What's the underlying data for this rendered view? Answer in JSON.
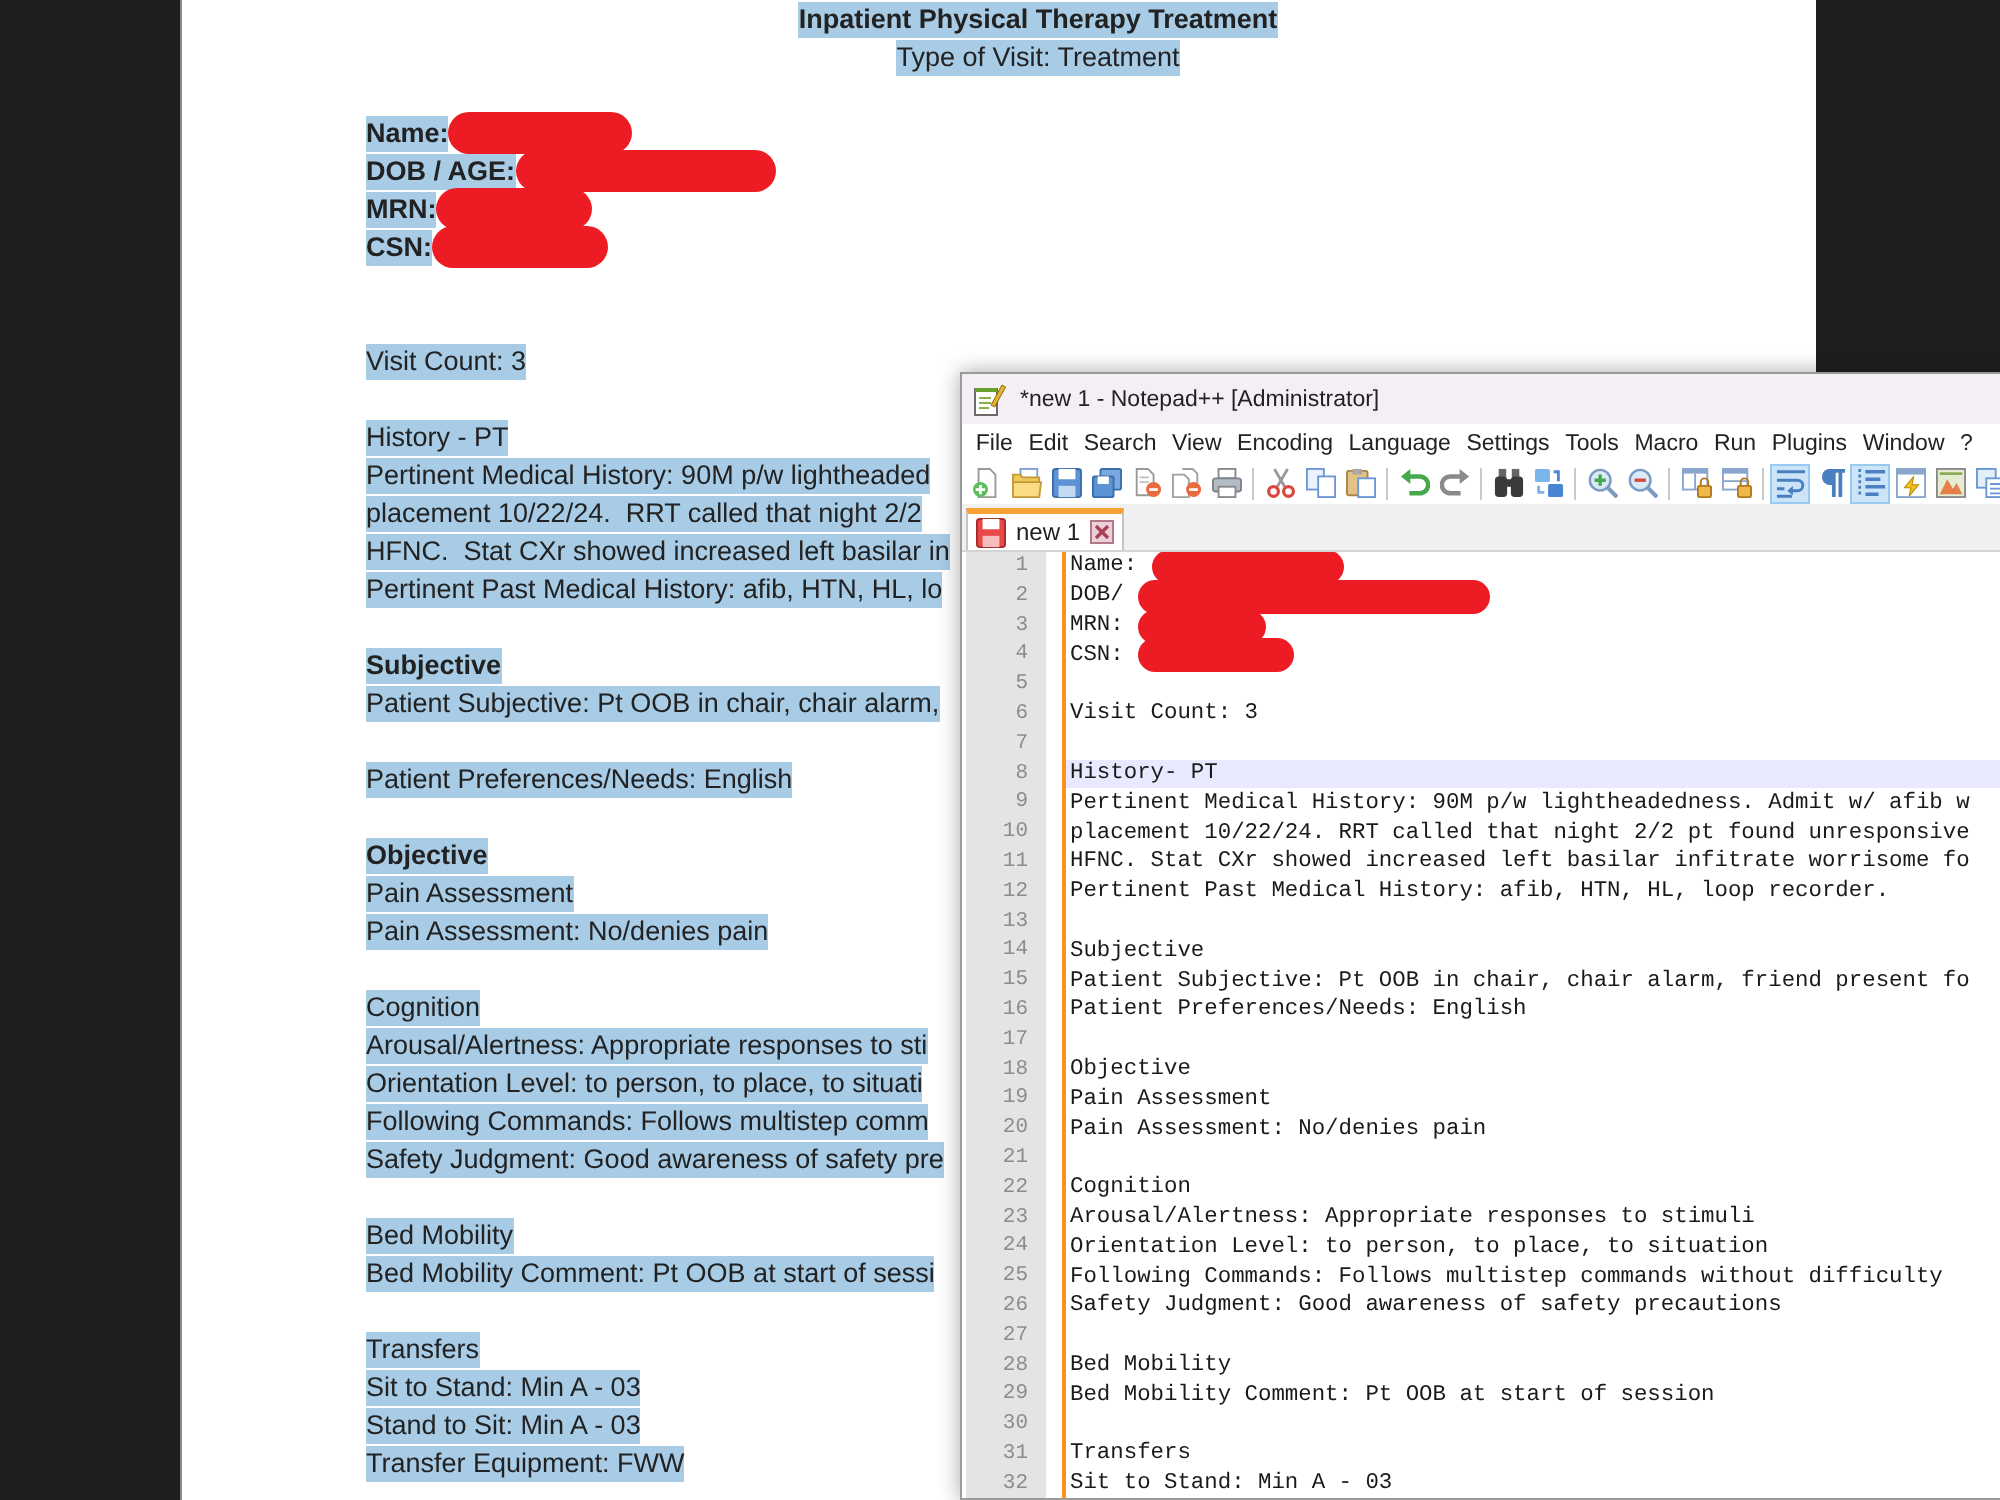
{
  "document": {
    "selected": true,
    "title": "Inpatient Physical Therapy Treatment",
    "subtitle": "Type of Visit: Treatment",
    "identifiers": [
      {
        "label": "Name:"
      },
      {
        "label": "DOB / AGE:"
      },
      {
        "label": "MRN:"
      },
      {
        "label": "CSN:"
      }
    ],
    "sections": [
      {
        "lines": [
          {
            "text": "Visit Count: 3",
            "bold": false
          }
        ]
      },
      {
        "lines": [
          {
            "text": "History - PT",
            "bold": false
          },
          {
            "text": "Pertinent Medical History: 90M p/w lightheaded",
            "bold": false
          },
          {
            "text": "placement 10/22/24.  RRT called that night 2/2",
            "bold": false
          },
          {
            "text": "HFNC.  Stat CXr showed increased left basilar in",
            "bold": false
          },
          {
            "text": "Pertinent Past Medical History: afib, HTN, HL, lo",
            "bold": false
          }
        ]
      },
      {
        "lines": [
          {
            "text": "Subjective",
            "bold": true
          },
          {
            "text": "Patient Subjective: Pt OOB in chair, chair alarm,",
            "bold": false
          }
        ]
      },
      {
        "lines": [
          {
            "text": "Patient Preferences/Needs: English",
            "bold": false
          }
        ]
      },
      {
        "lines": [
          {
            "text": "Objective",
            "bold": true
          },
          {
            "text": "Pain Assessment",
            "bold": false
          },
          {
            "text": "Pain Assessment: No/denies pain",
            "bold": false
          }
        ]
      },
      {
        "lines": [
          {
            "text": "Cognition",
            "bold": false
          },
          {
            "text": "Arousal/Alertness: Appropriate responses to sti",
            "bold": false
          },
          {
            "text": "Orientation Level: to person, to place, to situati",
            "bold": false
          },
          {
            "text": "Following Commands: Follows multistep comm",
            "bold": false
          },
          {
            "text": "Safety Judgment: Good awareness of safety pre",
            "bold": false
          }
        ]
      },
      {
        "lines": [
          {
            "text": "Bed Mobility",
            "bold": false
          },
          {
            "text": "Bed Mobility Comment: Pt OOB at start of sessi",
            "bold": false
          }
        ]
      },
      {
        "lines": [
          {
            "text": "Transfers",
            "bold": false
          },
          {
            "text": "Sit to Stand: Min A - 03",
            "bold": false
          },
          {
            "text": "Stand to Sit: Min A - 03",
            "bold": false
          },
          {
            "text": "Transfer Equipment: FWW",
            "bold": false
          }
        ]
      }
    ]
  },
  "notepad": {
    "title": "*new 1 - Notepad++ [Administrator]",
    "menu": [
      "File",
      "Edit",
      "Search",
      "View",
      "Encoding",
      "Language",
      "Settings",
      "Tools",
      "Macro",
      "Run",
      "Plugins",
      "Window",
      "?"
    ],
    "toolbar": [
      {
        "buttons": [
          {
            "kind": "new",
            "pressed": false
          },
          {
            "kind": "open",
            "pressed": false
          },
          {
            "kind": "save",
            "pressed": false
          },
          {
            "kind": "saveall",
            "pressed": false
          },
          {
            "kind": "close",
            "pressed": false
          },
          {
            "kind": "closeall",
            "pressed": false
          },
          {
            "kind": "print",
            "pressed": false
          }
        ]
      },
      {
        "buttons": [
          {
            "kind": "cut",
            "pressed": false
          },
          {
            "kind": "copy",
            "pressed": false
          },
          {
            "kind": "paste",
            "pressed": false
          }
        ]
      },
      {
        "buttons": [
          {
            "kind": "undo",
            "pressed": false
          },
          {
            "kind": "redo",
            "pressed": false
          }
        ]
      },
      {
        "buttons": [
          {
            "kind": "find",
            "pressed": false
          },
          {
            "kind": "replace",
            "pressed": false
          }
        ]
      },
      {
        "buttons": [
          {
            "kind": "zoomin",
            "pressed": false
          },
          {
            "kind": "zoomout",
            "pressed": false
          }
        ]
      },
      {
        "buttons": [
          {
            "kind": "syncv",
            "pressed": false
          },
          {
            "kind": "synch",
            "pressed": false
          }
        ]
      },
      {
        "buttons": [
          {
            "kind": "wrap",
            "pressed": true
          },
          {
            "kind": "allchars",
            "pressed": false
          },
          {
            "kind": "indent",
            "pressed": true
          },
          {
            "kind": "udl",
            "pressed": false
          },
          {
            "kind": "docmap",
            "pressed": false
          },
          {
            "kind": "funclist",
            "pressed": false
          }
        ]
      }
    ],
    "tabs": [
      {
        "label": "new 1",
        "selected": true,
        "modified": true
      }
    ],
    "lines": [
      {
        "number": "1",
        "text": "Name:",
        "redacted": true,
        "current": false
      },
      {
        "number": "2",
        "text": "DOB/",
        "redacted": true,
        "current": false
      },
      {
        "number": "3",
        "text": "MRN:",
        "redacted": true,
        "current": false
      },
      {
        "number": "4",
        "text": "CSN:",
        "redacted": true,
        "current": false
      },
      {
        "number": "5",
        "redacted": false,
        "current": false
      },
      {
        "number": "6",
        "text": "Visit Count: 3",
        "redacted": false,
        "current": false
      },
      {
        "number": "7",
        "redacted": false,
        "current": false
      },
      {
        "number": "8",
        "text": "History- PT",
        "redacted": false,
        "current": true
      },
      {
        "number": "9",
        "text": "Pertinent Medical History: 90M p/w lightheadedness. Admit w/ afib w",
        "redacted": false,
        "current": false
      },
      {
        "number": "10",
        "text": "placement 10/22/24. RRT called that night 2/2 pt found unresponsive",
        "redacted": false,
        "current": false
      },
      {
        "number": "11",
        "text": "HFNC. Stat CXr showed increased left basilar infitrate worrisome fo",
        "redacted": false,
        "current": false
      },
      {
        "number": "12",
        "text": "Pertinent Past Medical History: afib, HTN, HL, loop recorder.",
        "redacted": false,
        "current": false
      },
      {
        "number": "13",
        "redacted": false,
        "current": false
      },
      {
        "number": "14",
        "text": "Subjective",
        "redacted": false,
        "current": false
      },
      {
        "number": "15",
        "text": "Patient Subjective: Pt OOB in chair, chair alarm, friend present fo",
        "redacted": false,
        "current": false
      },
      {
        "number": "16",
        "text": "Patient Preferences/Needs: English",
        "redacted": false,
        "current": false
      },
      {
        "number": "17",
        "redacted": false,
        "current": false
      },
      {
        "number": "18",
        "text": "Objective",
        "redacted": false,
        "current": false
      },
      {
        "number": "19",
        "text": "Pain Assessment",
        "redacted": false,
        "current": false
      },
      {
        "number": "20",
        "text": "Pain Assessment: No/denies pain",
        "redacted": false,
        "current": false
      },
      {
        "number": "21",
        "redacted": false,
        "current": false
      },
      {
        "number": "22",
        "text": "Cognition",
        "redacted": false,
        "current": false
      },
      {
        "number": "23",
        "text": "Arousal/Alertness: Appropriate responses to stimuli",
        "redacted": false,
        "current": false
      },
      {
        "number": "24",
        "text": "Orientation Level: to person, to place, to situation",
        "redacted": false,
        "current": false
      },
      {
        "number": "25",
        "text": "Following Commands: Follows multistep commands without difficulty",
        "redacted": false,
        "current": false
      },
      {
        "number": "26",
        "text": "Safety Judgment: Good awareness of safety precautions",
        "redacted": false,
        "current": false
      },
      {
        "number": "27",
        "redacted": false,
        "current": false
      },
      {
        "number": "28",
        "text": "Bed Mobility",
        "redacted": false,
        "current": false
      },
      {
        "number": "29",
        "text": "Bed Mobility Comment: Pt OOB at start of session",
        "redacted": false,
        "current": false
      },
      {
        "number": "30",
        "redacted": false,
        "current": false
      },
      {
        "number": "31",
        "text": "Transfers",
        "redacted": false,
        "current": false
      },
      {
        "number": "32",
        "text": "Sit to Stand: Min A - 03",
        "redacted": false,
        "current": false
      }
    ]
  }
}
